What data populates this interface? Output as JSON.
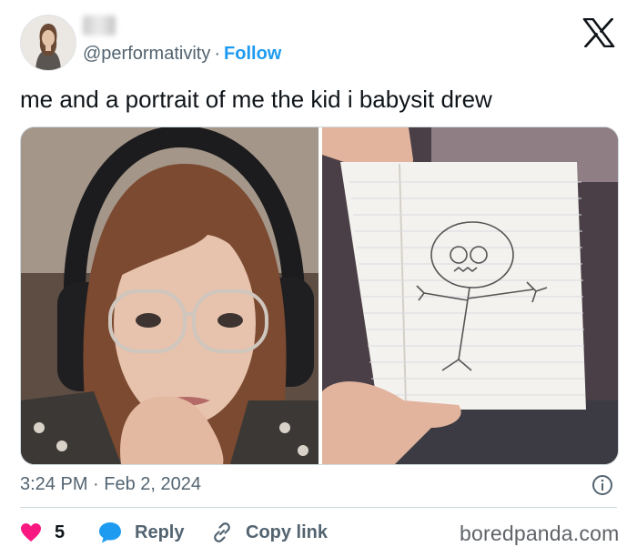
{
  "tweet": {
    "handle": "@performativity",
    "separator": "·",
    "follow_label": "Follow",
    "text": "me and a portrait of me the kid i babysit drew",
    "timestamp": "3:24 PM · Feb 2, 2024"
  },
  "images": [
    {
      "icon": "selfie-photo"
    },
    {
      "icon": "notebook-drawing-photo"
    }
  ],
  "actions": {
    "like_count": "5",
    "reply_label": "Reply",
    "copy_label": "Copy link"
  },
  "watermark": "boredpanda.com",
  "colors": {
    "accent": "#1d9bf0",
    "like": "#f91880",
    "secondary_text": "#536471"
  }
}
